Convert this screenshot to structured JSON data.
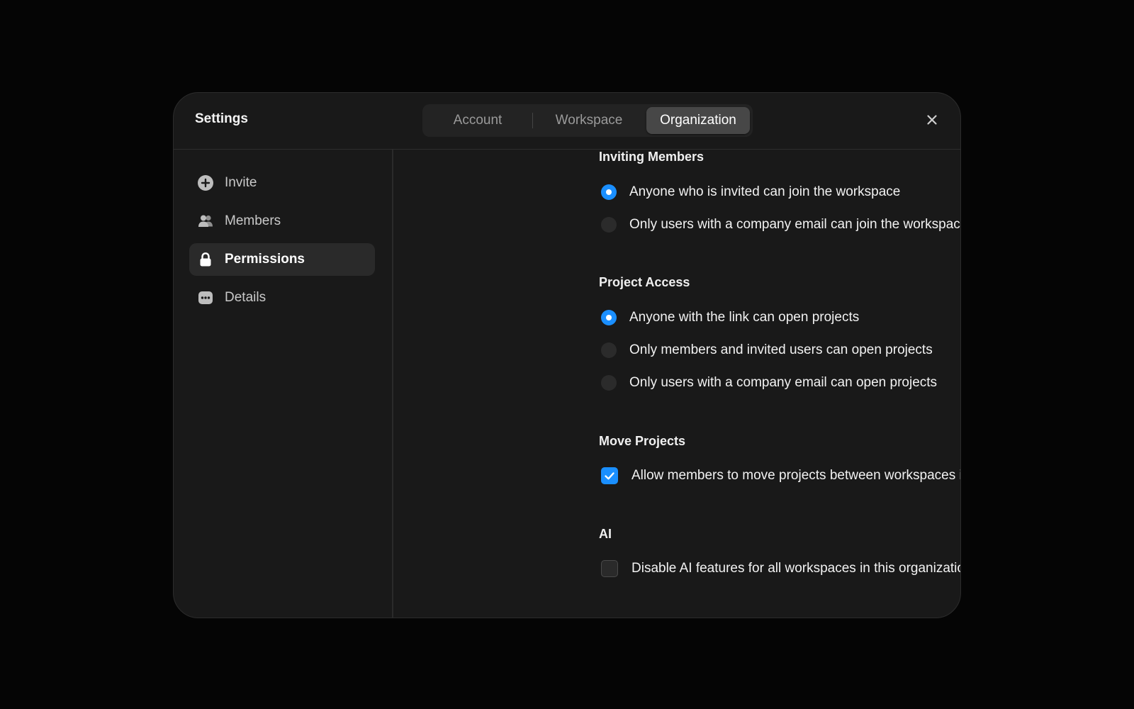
{
  "dialog": {
    "title": "Settings",
    "close_icon": "close-icon"
  },
  "tabs": [
    {
      "label": "Account",
      "active": false
    },
    {
      "label": "Workspace",
      "active": false
    },
    {
      "label": "Organization",
      "active": true
    }
  ],
  "sidebar": {
    "items": [
      {
        "label": "Invite",
        "icon": "plus-circle-icon",
        "active": false
      },
      {
        "label": "Members",
        "icon": "users-icon",
        "active": false
      },
      {
        "label": "Permissions",
        "icon": "lock-icon",
        "active": true
      },
      {
        "label": "Details",
        "icon": "details-icon",
        "active": false
      }
    ]
  },
  "sections": {
    "inviting": {
      "title": "Inviting Members",
      "options": [
        {
          "label": "Anyone who is invited can join the workspace",
          "selected": true
        },
        {
          "label": "Only users with a company email can join the workspace",
          "selected": false
        }
      ]
    },
    "project_access": {
      "title": "Project Access",
      "options": [
        {
          "label": "Anyone with the link can open projects",
          "selected": true
        },
        {
          "label": "Only members and invited users can open projects",
          "selected": false
        },
        {
          "label": "Only users with a company email can open projects",
          "selected": false
        }
      ]
    },
    "move_projects": {
      "title": "Move Projects",
      "checkbox": {
        "label": "Allow members to move projects between workspaces in the organization",
        "checked": true
      }
    },
    "ai": {
      "title": "AI",
      "checkbox": {
        "label": "Disable AI features for all workspaces in this organization",
        "checked": false
      }
    }
  },
  "colors": {
    "accent": "#1a8fff",
    "background": "#050505",
    "panel": "#191919"
  }
}
